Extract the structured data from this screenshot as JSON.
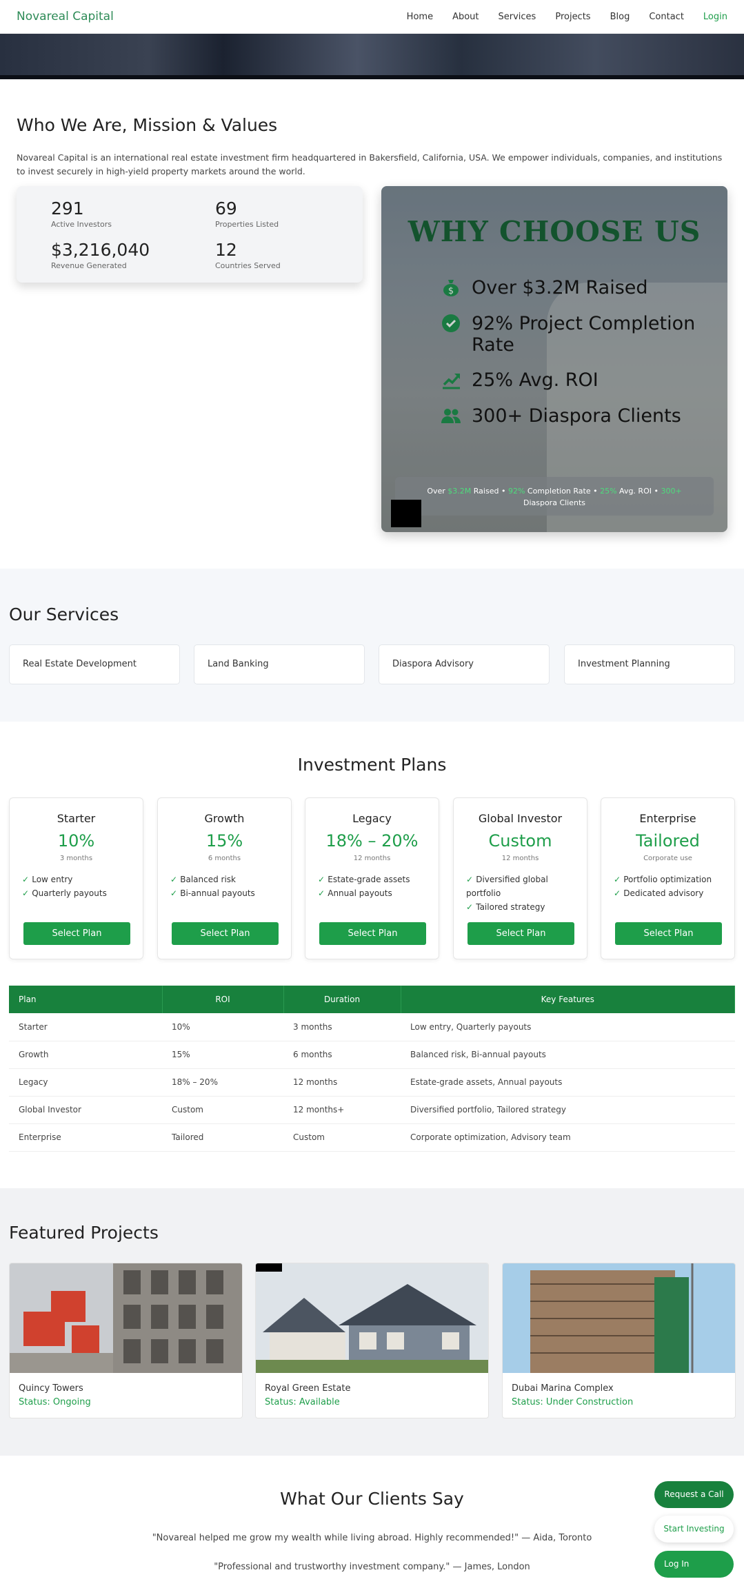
{
  "nav": {
    "brand": "Novareal Capital",
    "links": [
      "Home",
      "About",
      "Services",
      "Projects",
      "Blog",
      "Contact"
    ],
    "login": "Login"
  },
  "about": {
    "title": "Who We Are, Mission & Values",
    "text": "Novareal Capital is an international real estate investment firm headquartered in Bakersfield, California, USA. We empower individuals, companies, and institutions to invest securely in high-yield property markets around the world.",
    "stats": [
      {
        "num": "291",
        "label": "Active Investors"
      },
      {
        "num": "69",
        "label": "Properties Listed"
      },
      {
        "num": "$3,216,040",
        "label": "Revenue Generated"
      },
      {
        "num": "12",
        "label": "Countries Served"
      }
    ]
  },
  "why": {
    "title": "WHY CHOOSE US",
    "items": [
      {
        "icon": "money-bag-icon",
        "text": "Over $3.2M Raised"
      },
      {
        "icon": "check-circle-icon",
        "text": "92% Project Completion Rate"
      },
      {
        "icon": "chart-up-icon",
        "text": "25% Avg. ROI"
      },
      {
        "icon": "users-icon",
        "text": "300+ Diaspora Clients"
      }
    ],
    "bar": {
      "p1": "Over ",
      "v1": "$3.2M",
      "p2": " Raised • ",
      "v2": "92%",
      "p3": " Completion Rate • ",
      "v3": "25%",
      "p4": " Avg. ROI • ",
      "v4": "300+",
      "p5": " Diaspora Clients"
    }
  },
  "services": {
    "title": "Our Services",
    "items": [
      "Real Estate Development",
      "Land Banking",
      "Diaspora Advisory",
      "Investment Planning"
    ]
  },
  "plans": {
    "title": "Investment Plans",
    "cards": [
      {
        "name": "Starter",
        "roi": "10%",
        "duration": "3 months",
        "features": [
          "Low entry",
          "Quarterly payouts"
        ],
        "button": "Select Plan"
      },
      {
        "name": "Growth",
        "roi": "15%",
        "duration": "6 months",
        "features": [
          "Balanced risk",
          "Bi-annual payouts"
        ],
        "button": "Select Plan"
      },
      {
        "name": "Legacy",
        "roi": "18% – 20%",
        "duration": "12 months",
        "features": [
          "Estate-grade assets",
          "Annual payouts"
        ],
        "button": "Select Plan"
      },
      {
        "name": "Global Investor",
        "roi": "Custom",
        "duration": "12 months",
        "features": [
          "Diversified global portfolio",
          "Tailored strategy"
        ],
        "button": "Select Plan"
      },
      {
        "name": "Enterprise",
        "roi": "Tailored",
        "duration": "Corporate use",
        "features": [
          "Portfolio optimization",
          "Dedicated advisory"
        ],
        "button": "Select Plan"
      }
    ],
    "table": {
      "headers": [
        "Plan",
        "ROI",
        "Duration",
        "Key Features"
      ],
      "rows": [
        [
          "Starter",
          "10%",
          "3 months",
          "Low entry, Quarterly payouts"
        ],
        [
          "Growth",
          "15%",
          "6 months",
          "Balanced risk, Bi-annual payouts"
        ],
        [
          "Legacy",
          "18% – 20%",
          "12 months",
          "Estate-grade assets, Annual payouts"
        ],
        [
          "Global Investor",
          "Custom",
          "12 months+",
          "Diversified portfolio, Tailored strategy"
        ],
        [
          "Enterprise",
          "Tailored",
          "Custom",
          "Corporate optimization, Advisory team"
        ]
      ]
    }
  },
  "featured": {
    "title": "Featured Projects",
    "projects": [
      {
        "name": "Quincy Towers",
        "status": "Status: Ongoing"
      },
      {
        "name": "Royal Green Estate",
        "status": "Status: Available"
      },
      {
        "name": "Dubai Marina Complex",
        "status": "Status: Under Construction"
      }
    ]
  },
  "testimonials": {
    "title": "What Our Clients Say",
    "quotes": [
      "\"Novareal helped me grow my wealth while living abroad. Highly recommended!\" — Aida, Toronto",
      "\"Professional and trustworthy investment company.\" — James, London"
    ]
  },
  "fabs": {
    "call": "Request a Call",
    "invest": "Start Investing",
    "login": "Log In"
  },
  "colors": {
    "accent": "#1e9e4a",
    "dark_green": "#18813d",
    "title_green": "#13532d"
  }
}
